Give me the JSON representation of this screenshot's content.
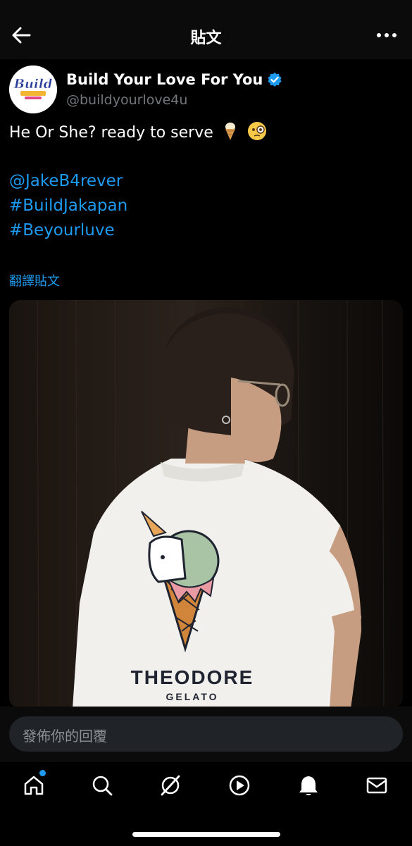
{
  "header": {
    "title": "貼文"
  },
  "post": {
    "author_name": "Build Your Love For You",
    "author_handle": "@buildyourlove4u",
    "avatar_text": "Build",
    "text": "He Or She? ready to serve",
    "emojis": [
      "ice-cream-icon",
      "monocle-face-icon"
    ],
    "links": [
      "@JakeB4rever",
      "#BuildJakapan",
      "#Beyourluve"
    ],
    "translate_label": "翻譯貼文",
    "image": {
      "description_icon": "photo-person-in-white-polo",
      "shirt_text_1": "THEODORE",
      "shirt_text_2": "GELATO"
    }
  },
  "reply": {
    "placeholder": "發佈你的回覆"
  },
  "tabbar": {
    "items": [
      "home-icon",
      "search-icon",
      "grok-icon",
      "video-icon",
      "notifications-icon",
      "messages-icon"
    ],
    "accent": "#1d9bf0"
  }
}
